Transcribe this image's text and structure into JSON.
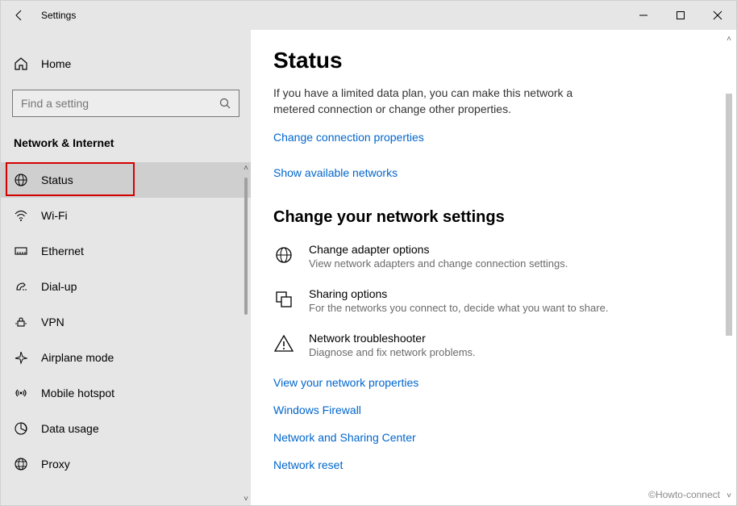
{
  "titlebar": {
    "app_title": "Settings"
  },
  "sidebar": {
    "home_label": "Home",
    "search_placeholder": "Find a setting",
    "category_header": "Network & Internet",
    "items": [
      {
        "label": "Status",
        "icon": "globe-icon",
        "selected": true,
        "highlighted": true
      },
      {
        "label": "Wi-Fi",
        "icon": "wifi-icon",
        "selected": false,
        "highlighted": false
      },
      {
        "label": "Ethernet",
        "icon": "ethernet-icon",
        "selected": false,
        "highlighted": false
      },
      {
        "label": "Dial-up",
        "icon": "dialup-icon",
        "selected": false,
        "highlighted": false
      },
      {
        "label": "VPN",
        "icon": "vpn-icon",
        "selected": false,
        "highlighted": false
      },
      {
        "label": "Airplane mode",
        "icon": "airplane-icon",
        "selected": false,
        "highlighted": false
      },
      {
        "label": "Mobile hotspot",
        "icon": "hotspot-icon",
        "selected": false,
        "highlighted": false
      },
      {
        "label": "Data usage",
        "icon": "data-usage-icon",
        "selected": false,
        "highlighted": false
      },
      {
        "label": "Proxy",
        "icon": "proxy-icon",
        "selected": false,
        "highlighted": false
      }
    ]
  },
  "content": {
    "heading": "Status",
    "description": "If you have a limited data plan, you can make this network a metered connection or change other properties.",
    "link_change_properties": "Change connection properties",
    "link_show_networks": "Show available networks",
    "section_heading": "Change your network settings",
    "options": [
      {
        "title": "Change adapter options",
        "subtitle": "View network adapters and change connection settings.",
        "icon": "adapter-icon"
      },
      {
        "title": "Sharing options",
        "subtitle": "For the networks you connect to, decide what you want to share.",
        "icon": "sharing-icon"
      },
      {
        "title": "Network troubleshooter",
        "subtitle": "Diagnose and fix network problems.",
        "icon": "warning-icon"
      }
    ],
    "link_view_props": "View your network properties",
    "link_firewall": "Windows Firewall",
    "link_sharing_center": "Network and Sharing Center",
    "link_reset": "Network reset"
  },
  "watermark": "©Howto-connect"
}
